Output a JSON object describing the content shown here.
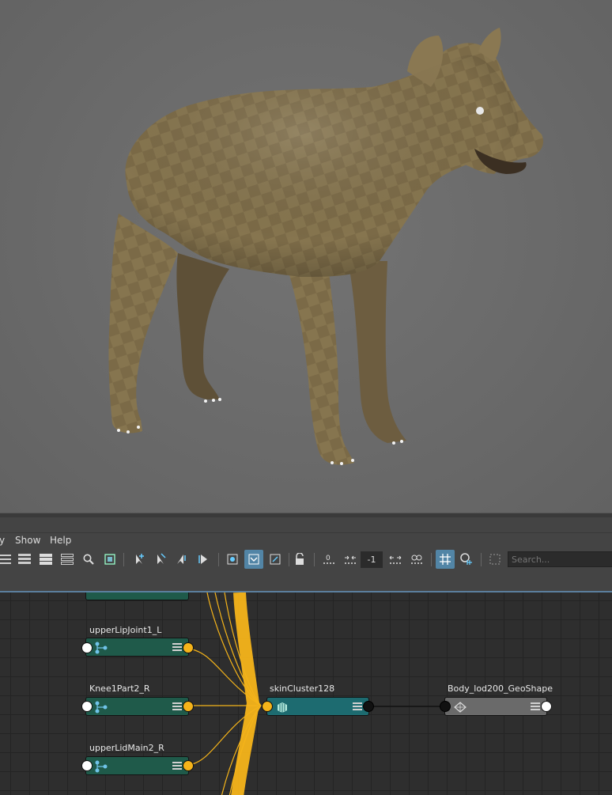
{
  "menu": {
    "items": [
      "y",
      "Show",
      "Help"
    ]
  },
  "toolbar": {
    "frame_value": "-1",
    "search_placeholder": "Search..."
  },
  "graph": {
    "nodes": {
      "joint_top": "",
      "upper_lip": "upperLipJoint1_L",
      "knee": "Knee1Part2_R",
      "lid": "upperLidMain2_R",
      "skin_cluster": "skinCluster128",
      "body_shape": "Body_lod200_GeoShape"
    }
  },
  "colors": {
    "viewport_bg": "#6a6a6a",
    "model_fur": "#7a6a48",
    "wire_orange": "#f5b41a",
    "joint_node": "#1f5a4a",
    "skin_node": "#1d6b70",
    "shape_node": "#6a6a6a",
    "selected_tool": "#5285a6"
  }
}
